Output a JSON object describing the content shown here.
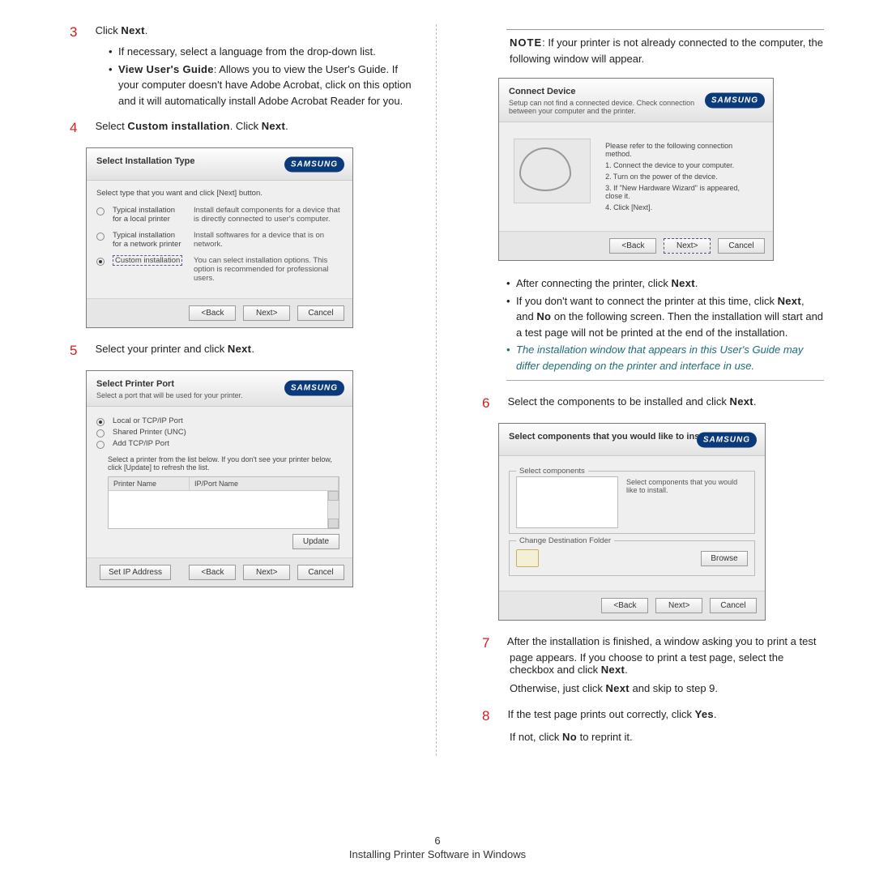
{
  "brand": "SAMSUNG",
  "buttons": {
    "back": "<Back",
    "next": "Next>",
    "cancel": "Cancel",
    "update": "Update",
    "setip": "Set IP Address",
    "browse": "Browse"
  },
  "left": {
    "s3": {
      "n": "3",
      "lead_a": "Click ",
      "lead_b": "Next",
      "lead_c": ".",
      "b1": "If necessary, select a language from the drop-down list.",
      "b2_a": "View User's Guide",
      "b2_b": ": Allows you to view the User's Guide. If your computer doesn't have Adobe Acrobat, click on this option and it will automatically install Adobe Acrobat Reader for you."
    },
    "s4": {
      "n": "4",
      "t_a": "Select ",
      "t_b": "Custom installation",
      "t_c": ". Click ",
      "t_d": "Next",
      "t_e": "."
    },
    "s5": {
      "n": "5",
      "t_a": "Select your printer and click ",
      "t_b": "Next",
      "t_c": "."
    },
    "dlg1": {
      "title": "Select Installation Type",
      "sub": "Select type that you want and click [Next] button.",
      "r1_l": "Typical installation for a local printer",
      "r1_d": "Install default components for a device that is directly connected to user's computer.",
      "r2_l": "Typical installation for a network printer",
      "r2_d": "Install softwares for a device that is on network.",
      "r3_l": "Custom installation",
      "r3_d": "You can select installation options. This option is recommended for professional users."
    },
    "dlg2": {
      "title": "Select Printer Port",
      "sub": "Select a port that will be used for your printer.",
      "o1": "Local or TCP/IP Port",
      "o2": "Shared Printer (UNC)",
      "o3": "Add TCP/IP Port",
      "hint": "Select a printer from the list below. If you don't see your printer below, click [Update] to refresh the list.",
      "col1": "Printer Name",
      "col2": "IP/Port Name"
    }
  },
  "right": {
    "note_l": "NOTE",
    "note_t": ": If your printer is not already connected to the computer, the following window will appear.",
    "dlg3": {
      "title": "Connect Device",
      "sub": "Setup can not find a connected device. Check connection between your computer and the printer.",
      "intro": "Please refer to the following connection method.",
      "s1": "1. Connect the device to your computer.",
      "s2": "2. Turn on the power of the device.",
      "s3": "3. If \"New Hardware Wizard\" is appeared, close it.",
      "s4": "4. Click [Next]."
    },
    "b1_a": "After connecting the printer, click ",
    "b1_b": "Next",
    "b1_c": ".",
    "b2_a": "If you don't want to connect the printer at this time, click ",
    "b2_b": "Next",
    "b2_c": ", and ",
    "b2_d": "No",
    "b2_e": " on the following screen. Then the installation will start and a test page will not be printed at the end of the installation.",
    "b3": "The installation window that appears in this User's Guide may differ depending on the printer and interface in use.",
    "s6": {
      "n": "6",
      "t_a": "Select the components to be installed and click ",
      "t_b": "Next",
      "t_c": "."
    },
    "dlg4": {
      "title": "Select components that you would like to install",
      "leg1": "Select components",
      "note": "Select components that you would like to install.",
      "leg2": "Change Destination Folder"
    },
    "s7": {
      "n": "7",
      "t_a": "After the installation is finished, a window asking you to print a test page appears. If you choose to print a test page, select the checkbox and click ",
      "t_b": "Next",
      "t_c": ".",
      "t2_a": "Otherwise, just click ",
      "t2_b": "Next",
      "t2_c": " and skip to step 9."
    },
    "s8": {
      "n": "8",
      "t_a": "If the test page prints out correctly, click ",
      "t_b": "Yes",
      "t_c": ".",
      "t2_a": "If not, click ",
      "t2_b": "No",
      "t2_c": " to reprint it."
    }
  },
  "footer": {
    "page": "6",
    "title": "Installing Printer Software in Windows"
  }
}
